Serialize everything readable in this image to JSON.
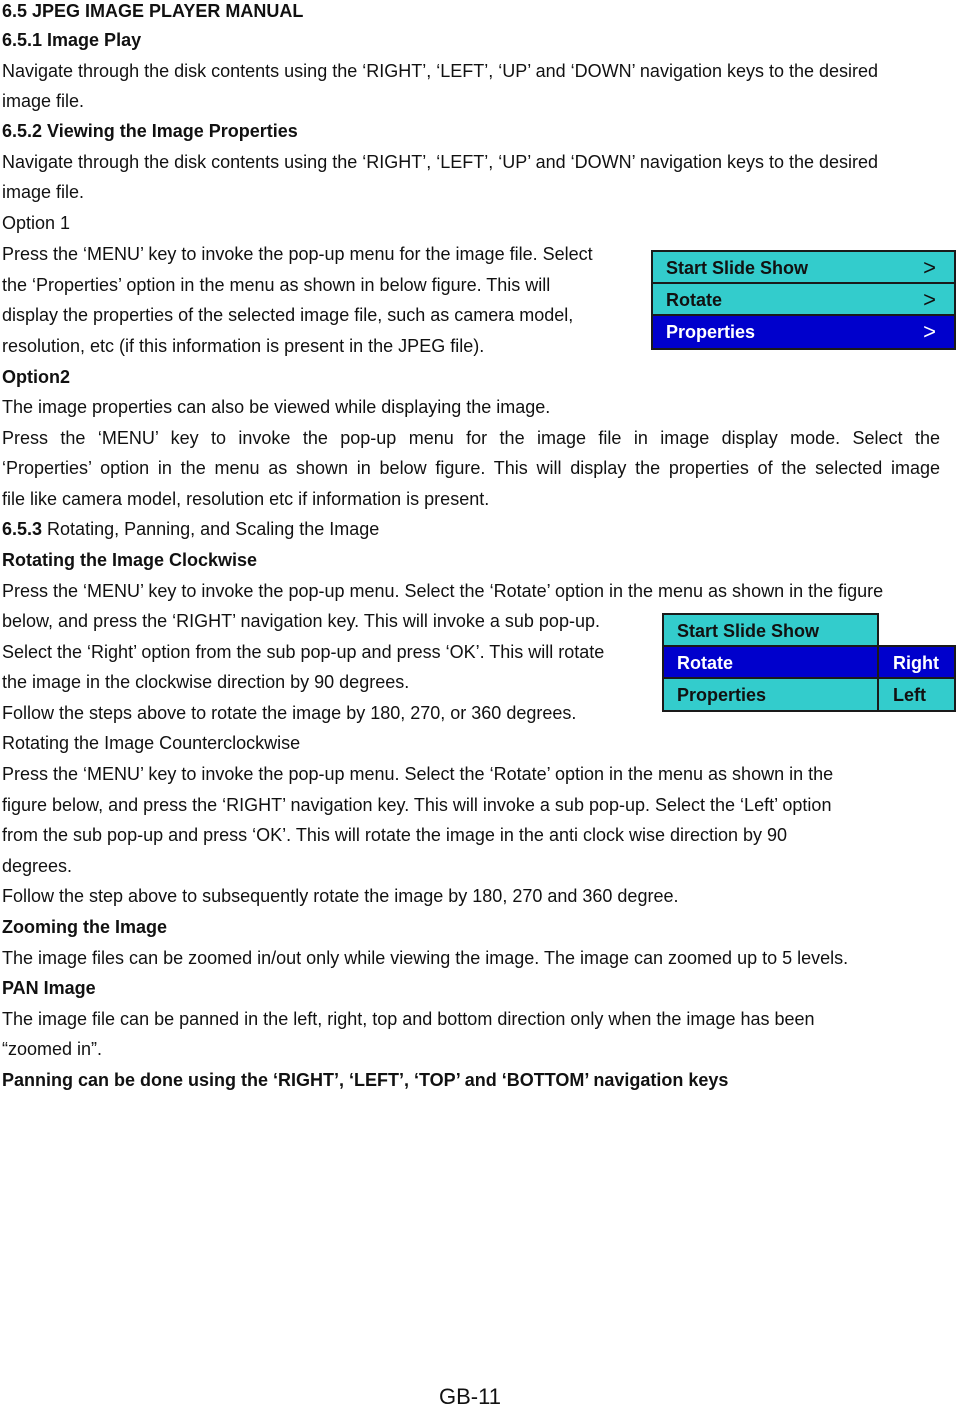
{
  "section_title": "6.5 JPEG IMAGE PLAYER MANUAL",
  "s651": {
    "heading": "6.5.1 Image Play",
    "lines": [
      "Navigate through the disk contents using the ‘RIGHT’, ‘LEFT’, ‘UP’ and ‘DOWN’ navigation keys to the desired",
      "image file."
    ]
  },
  "s652": {
    "heading": "6.5.2 Viewing the Image Properties",
    "lines": [
      "Navigate through the disk contents using the ‘RIGHT’, ‘LEFT’, ‘UP’ and ‘DOWN’ navigation keys to the desired",
      "image file."
    ],
    "option1": {
      "heading": "Option 1",
      "lines": [
        "Press the ‘MENU’ key to invoke the pop-up menu for the image file. Select",
        "the ‘Properties’ option in the menu as shown in below figure. This will",
        "display the properties of the selected image file, such as camera model,",
        "resolution, etc (if this information is present in the JPEG file)."
      ]
    },
    "option2": {
      "heading": "Option2",
      "lines": [
        "The image properties can also be viewed while displaying the image.",
        "Press the ‘MENU’ key to invoke the pop-up menu for the image file in image display mode. Select the",
        "‘Properties’ option in the menu as shown in below figure. This will display the properties of the selected image",
        "file like camera model, resolution etc if information is present."
      ]
    },
    "menu1": [
      {
        "label": "Start Slide Show",
        "arrow": ">",
        "selected": false
      },
      {
        "label": "Rotate",
        "arrow": ">",
        "selected": false
      },
      {
        "label": "Properties",
        "arrow": ">",
        "selected": true
      }
    ]
  },
  "s653": {
    "heading_num": "6.5.3",
    "heading_text": " Rotating, Panning, and Scaling the Image",
    "cw": {
      "heading": "Rotating the Image Clockwise",
      "lines": [
        "Press the ‘MENU’ key to invoke the pop-up menu. Select the ‘Rotate’ option in the menu as shown in the figure",
        "below, and press the ‘RIGHT’ navigation key. This will invoke a sub pop-up.",
        "Select the ‘Right’ option from the sub pop-up and press ‘OK’. This will rotate",
        "the image in the clockwise direction by 90 degrees.",
        "Follow the steps above to rotate the image by 180, 270, or 360 degrees."
      ]
    },
    "menu2": {
      "items": [
        {
          "label": "Start Slide Show",
          "selected": false
        },
        {
          "label": "Rotate",
          "selected": true
        },
        {
          "label": "Properties",
          "selected": false
        }
      ],
      "sub_items": [
        {
          "label": "Right",
          "selected": true
        },
        {
          "label": "Left",
          "selected": false
        }
      ]
    },
    "ccw": {
      "heading": "Rotating the Image Counterclockwise",
      "lines": [
        "Press the ‘MENU’ key to invoke the pop-up menu. Select the ‘Rotate’ option in the menu as shown in the",
        "figure below, and press the ‘RIGHT’ navigation key. This will invoke a sub pop-up. Select the ‘Left’ option",
        "from the sub pop-up and press ‘OK’. This will rotate the image in the anti clock wise direction by 90",
        "degrees.",
        "Follow the step above to subsequently rotate the image by 180, 270 and 360 degree."
      ]
    },
    "zoom": {
      "heading": "Zooming the Image",
      "lines": [
        "The image files can be zoomed in/out only while viewing the image. The image can zoomed up to 5 levels."
      ]
    },
    "pan": {
      "heading": "PAN Image",
      "lines": [
        "The image file can be panned in the left, right, top and bottom direction only when the image has been",
        "“zoomed in”."
      ],
      "note": "Panning can be done using the ‘RIGHT’, ‘LEFT’, ‘TOP’ and ‘BOTTOM’ navigation keys"
    }
  },
  "footer": {
    "page_number": "GB-11"
  },
  "colors": {
    "menu_cyan": "#33cccc",
    "menu_selected_blue": "#0000cc"
  }
}
